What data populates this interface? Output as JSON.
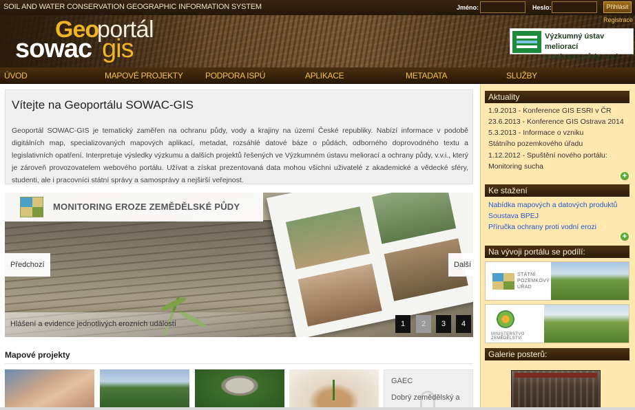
{
  "system_title": "SOIL AND WATER CONSERVATION GEOGRAPHIC INFORMATION SYSTEM",
  "login": {
    "username_label": "Jméno:",
    "password_label": "Heslo:",
    "login_button": "Přihlásit",
    "register_link": "Registrace"
  },
  "logo": {
    "geo": "Geo",
    "portal": "portál",
    "sowac": "sowac",
    "gis": "gis"
  },
  "institute": {
    "line1": "Výzkumný ústav meliorací",
    "line2": "a ochrany půdy, v.v.i."
  },
  "nav": [
    "ÚVOD",
    "MAPOVÉ PROJEKTY",
    "PODPORA ISPÚ",
    "APLIKACE",
    "METADATA",
    "SLUŽBY"
  ],
  "welcome": {
    "title": "Vítejte na Geoportálu SOWAC-GIS",
    "text": "Geoportál SOWAC-GIS je tematický zaměřen na ochranu půdy, vody a krajiny na území České republiky. Nabízí informace v podobě digitálních map, specializovaných mapových aplikací, metadat, rozsáhlé datové báze o půdách, odborného doprovodného textu a legislativních opatření. Interpretuje výsledky výzkumu a dalších projektů řešených ve Výzkumném ústavu meliorací a ochrany půdy, v.v.i., který je zároveň provozovatelem webového portálu. Užívat a získat prezentovaná data mohou všichni uživatelé z akademické a vědecké sféry, studenti, ale i pracovníci státní správy a samosprávy a nejširší veřejnost."
  },
  "slider": {
    "banner_title": "MONITORING EROZE ZEMĚDĚLSKÉ PŮDY",
    "prev_label": "Předchozí",
    "next_label": "Další",
    "caption": "Hlášení a evidence jednotlivých erozních událostí",
    "pages": [
      "1",
      "2",
      "3",
      "4"
    ],
    "active_page": 2
  },
  "map_projects": {
    "heading": "Mapové projekty",
    "gaec_title": "GAEC",
    "gaec_subtitle": "Dobrý zemědělský a"
  },
  "sidebar": {
    "news_heading": "Aktuality",
    "news": [
      "1.9.2013 - Konference GIS ESRI v ČR",
      "23.6.2013 - Konference GIS Ostrava 2014",
      "5.3.2013 - Informace o vzniku Státního pozemkového úřadu",
      "1.12.2012 - Spuštění nového portálu: Monitoring sucha"
    ],
    "downloads_heading": "Ke stažení",
    "downloads": [
      "Nabídka mapových a datových produktů",
      "Soustava BPEJ",
      "Příručka ochrany proti vodní erozi"
    ],
    "partners_heading": "Na vývoji portálu se podílí:",
    "partner1_text": "STÁTNÍ POZEMKOVÝ ÚŘAD",
    "partner2_text": "MINISTERSTVO ZEMĚDĚLSTVÍ",
    "gallery_heading": "Galerie posterů:"
  },
  "colors": {
    "nav_text": "#f4c24a",
    "link": "#2255cc",
    "sidebar_bg": "#ffe8b0",
    "header_brown": "#2d1c08"
  }
}
